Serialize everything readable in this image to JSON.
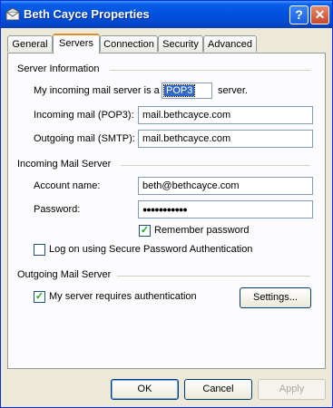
{
  "window": {
    "title": "Beth Cayce Properties",
    "help_label": "?",
    "close_label": "✕"
  },
  "tabs": [
    "General",
    "Servers",
    "Connection",
    "Security",
    "Advanced"
  ],
  "active_tab": "Servers",
  "server_info": {
    "heading": "Server Information",
    "incoming_prefix": "My incoming mail server is a",
    "server_type": "POP3",
    "incoming_suffix": "server.",
    "incoming_label": "Incoming mail (POP3):",
    "incoming_value": "mail.bethcayce.com",
    "outgoing_label": "Outgoing mail (SMTP):",
    "outgoing_value": "mail.bethcayce.com"
  },
  "incoming_server": {
    "heading": "Incoming Mail Server",
    "account_label": "Account name:",
    "account_value": "beth@bethcayce.com",
    "password_label": "Password:",
    "password_value": "●●●●●●●●●●●",
    "remember_label": "Remember password",
    "remember_checked": true,
    "spa_label": "Log on using Secure Password Authentication",
    "spa_checked": false
  },
  "outgoing_server": {
    "heading": "Outgoing Mail Server",
    "auth_label": "My server requires authentication",
    "auth_checked": true,
    "settings_label": "Settings..."
  },
  "buttons": {
    "ok": "OK",
    "cancel": "Cancel",
    "apply": "Apply"
  }
}
